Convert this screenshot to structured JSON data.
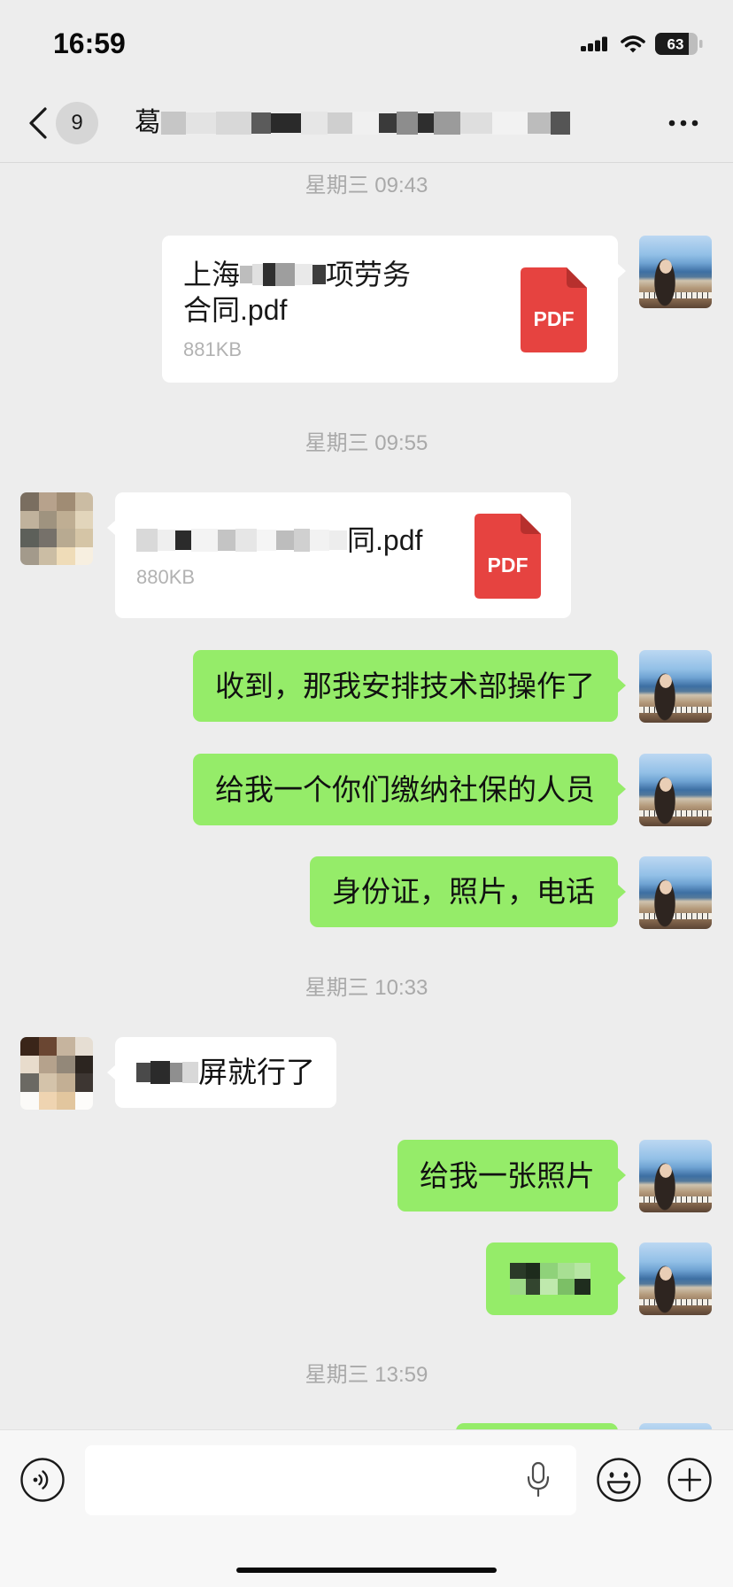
{
  "status_bar": {
    "time": "16:59",
    "battery": "63",
    "icons": [
      "signal-icon",
      "wifi-icon",
      "battery-icon"
    ]
  },
  "nav": {
    "badge": "9",
    "title": "葛",
    "icons": [
      "chevron-left-icon",
      "more-icon"
    ]
  },
  "messages": [
    {
      "timestamp": "星期三 09:43"
    },
    {
      "sent_file": {
        "name_start": "上海",
        "name_mid": "项劳务",
        "name_line2": "合同.pdf",
        "size": "881KB",
        "badge": "PDF"
      }
    },
    {
      "timestamp": "星期三 09:55"
    },
    {
      "received_file": {
        "name_end": "同.pdf",
        "size": "880KB",
        "badge": "PDF"
      }
    },
    {
      "sent_text": "收到，那我安排技术部操作了"
    },
    {
      "sent_text": "给我一个你们缴纳社保的人员"
    },
    {
      "sent_text": "身份证，照片，电话"
    },
    {
      "timestamp": "星期三 10:33"
    },
    {
      "received_text": "屏就行了"
    },
    {
      "sent_text": "给我一张照片"
    },
    {
      "timestamp": "星期三 13:59"
    }
  ],
  "input_bar": {
    "icons": [
      "voice-icon",
      "mic-icon",
      "emoji-icon",
      "plus-icon"
    ]
  },
  "colors": {
    "bubble_green": "#95ec69",
    "chat_background": "#ededed",
    "pdf_red": "#e64340"
  }
}
